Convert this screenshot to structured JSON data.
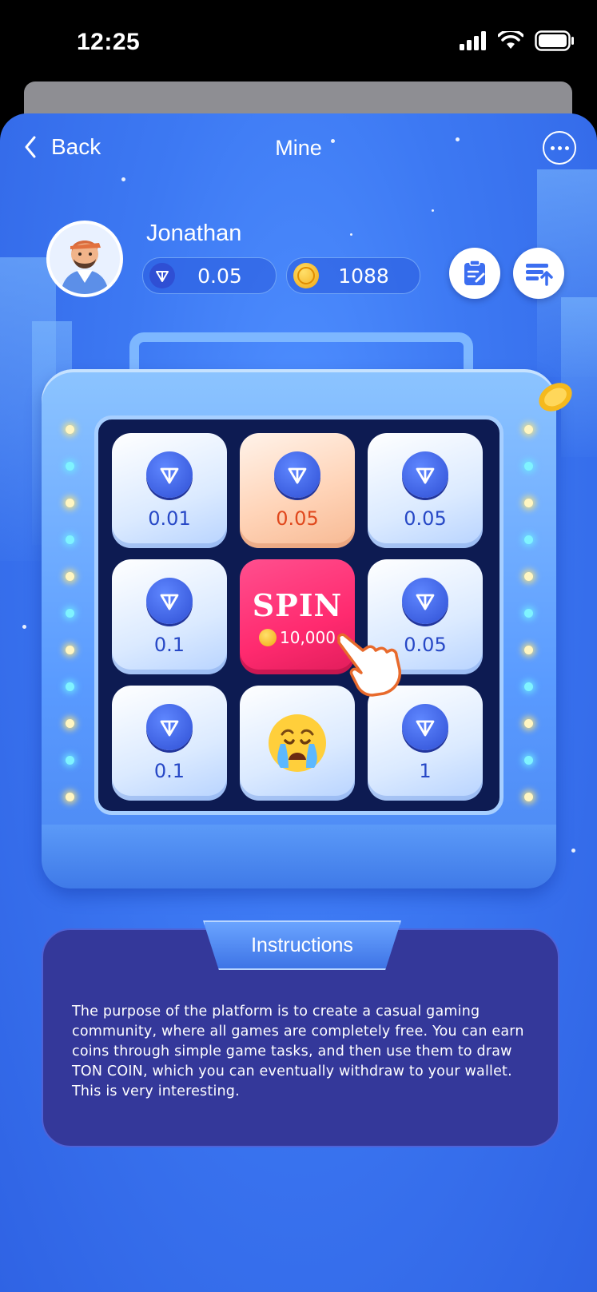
{
  "status_bar": {
    "time": "12:25"
  },
  "nav": {
    "back_label": "Back",
    "title": "Mine"
  },
  "profile": {
    "name": "Jonathan",
    "ton_balance": "0.05",
    "coin_balance": "1088"
  },
  "grid": {
    "cells": [
      {
        "amount": "0.01",
        "highlight": false
      },
      {
        "amount": "0.05",
        "highlight": true
      },
      {
        "amount": "0.05",
        "highlight": false
      },
      {
        "amount": "0.1",
        "highlight": false
      },
      {
        "amount": "0.05",
        "highlight": false
      },
      {
        "amount": "0.1",
        "highlight": false
      },
      {
        "amount": "1",
        "highlight": false
      }
    ],
    "spin_label": "SPIN",
    "spin_cost": "10,000"
  },
  "instructions": {
    "title": "Instructions",
    "text": "The purpose of the platform is to create a casual gaming community, where all games are completely free. You can earn coins through simple game tasks, and then use them to draw TON COIN, which you can eventually withdraw to your wallet. This is very interesting."
  },
  "colors": {
    "accent_blue": "#3d79f3",
    "spin_pink": "#ff2a6f",
    "instructions_bg": "#34389a"
  },
  "icons": [
    "chevron-left-icon",
    "more-icon",
    "ton-icon",
    "coin-icon",
    "tasks-icon",
    "withdraw-icon",
    "crying-emoji-icon",
    "hand-pointer-icon"
  ]
}
